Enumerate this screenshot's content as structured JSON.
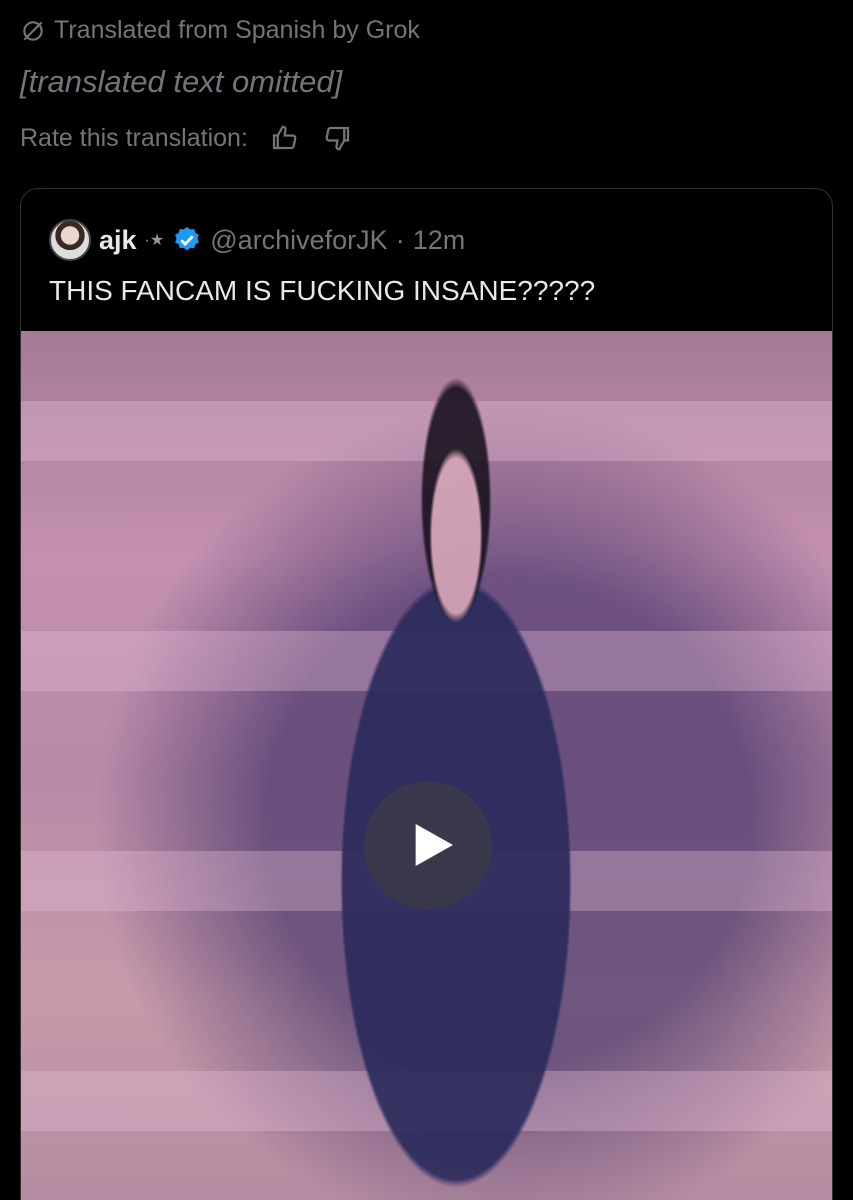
{
  "translation": {
    "meta_label": "Translated from Spanish by Grok",
    "text": "[translated text omitted]",
    "rate_label": "Rate this translation:"
  },
  "quote": {
    "display_name": "ajk",
    "handle": "@archiveforJK",
    "separator": "·",
    "time": "12m",
    "text": "THIS FANCAM IS FUCKING INSANE?????"
  },
  "colors": {
    "muted": "#71767b",
    "text": "#e7e9ea",
    "verified": "#1d9bf0",
    "border": "#2f3336"
  },
  "icons": [
    "grok-slash-icon",
    "thumbs-up-icon",
    "thumbs-down-icon",
    "verified-badge-icon",
    "play-icon"
  ]
}
